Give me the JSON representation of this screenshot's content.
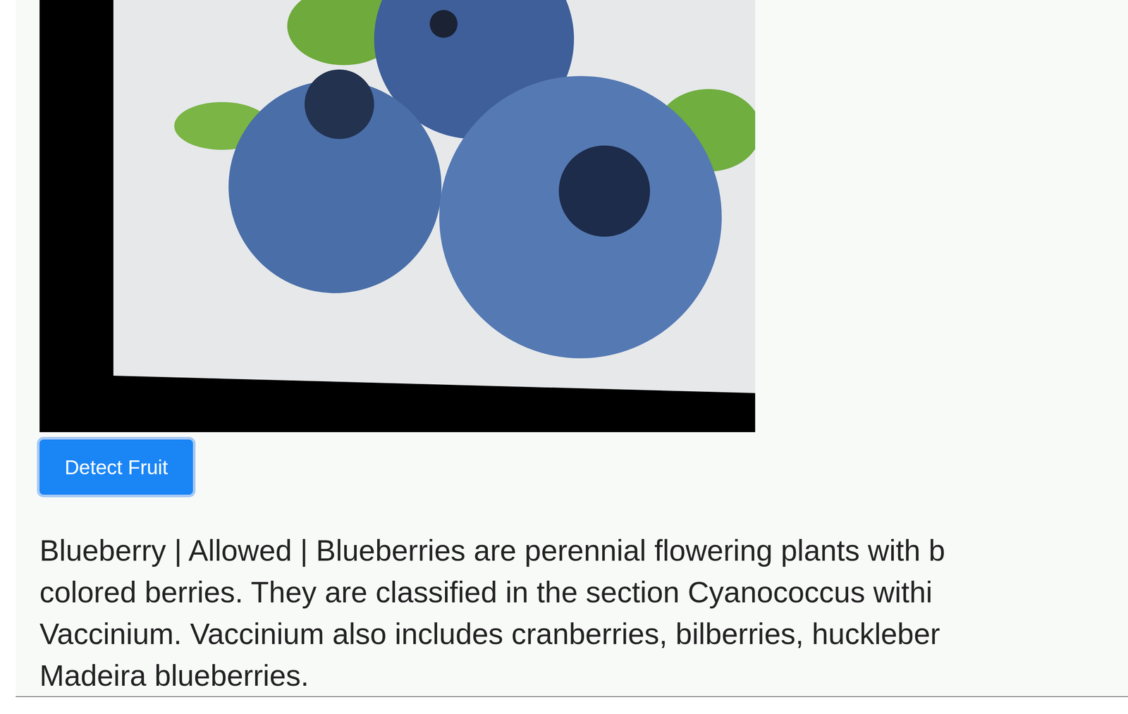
{
  "button": {
    "label": "Detect Fruit",
    "focused": true
  },
  "result": {
    "lines": [
      "Blueberry | Allowed | Blueberries are perennial flowering plants with b",
      "colored berries. They are classified in the section Cyanococcus withi",
      "Vaccinium. Vaccinium also includes cranberries, bilberries, huckleber",
      "Madeira blueberries."
    ]
  }
}
